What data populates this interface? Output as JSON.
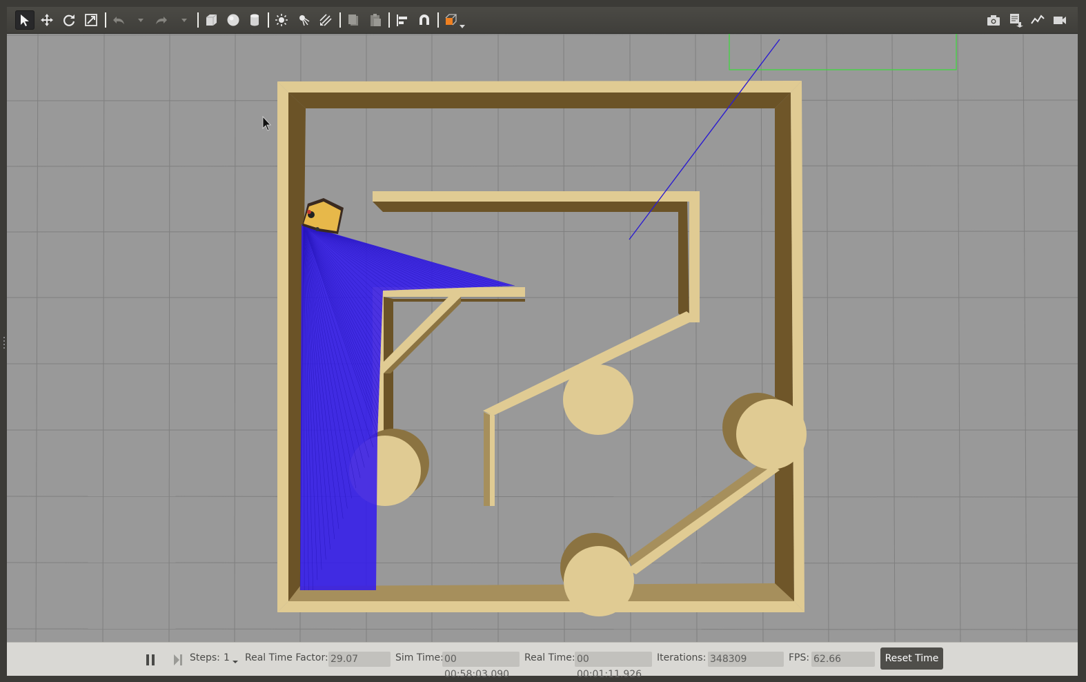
{
  "toolbar": {
    "tools": [
      {
        "name": "select-mode-icon",
        "active": true
      },
      {
        "name": "translate-mode-icon"
      },
      {
        "name": "rotate-mode-icon"
      },
      {
        "name": "scale-mode-icon"
      },
      {
        "name": "undo-icon"
      },
      {
        "name": "redo-icon"
      },
      {
        "name": "box-shape-icon"
      },
      {
        "name": "sphere-shape-icon"
      },
      {
        "name": "cylinder-shape-icon"
      },
      {
        "name": "point-light-icon"
      },
      {
        "name": "spot-light-icon"
      },
      {
        "name": "directional-light-icon"
      },
      {
        "name": "copy-icon"
      },
      {
        "name": "paste-icon"
      },
      {
        "name": "align-icon"
      },
      {
        "name": "snap-icon"
      },
      {
        "name": "view-angle-icon"
      },
      {
        "name": "screenshot-icon"
      },
      {
        "name": "log-icon"
      },
      {
        "name": "plot-icon"
      },
      {
        "name": "video-record-icon"
      }
    ]
  },
  "statusbar": {
    "steps_label": "Steps:",
    "steps_value": "1",
    "rtf_label": "Real Time Factor:",
    "rtf_value": "29.07",
    "sim_time_label": "Sim Time:",
    "sim_time_value": "00 00:58:03.090",
    "real_time_label": "Real Time:",
    "real_time_value": "00 00:01:11.926",
    "iterations_label": "Iterations:",
    "iterations_value": "348309",
    "fps_label": "FPS:",
    "fps_value": "62.66",
    "reset_label": "Reset Time"
  },
  "colors": {
    "viewport_bg": "#999999",
    "grid_line": "#7f7f7f",
    "wall_top": "#e0cb93",
    "wall_side_dark": "#6b5327",
    "wall_side_mid": "#a68f5c",
    "laser": "#2f1cf0",
    "selection_box": "#3adb3a",
    "robot_body": "#e7b84a"
  }
}
